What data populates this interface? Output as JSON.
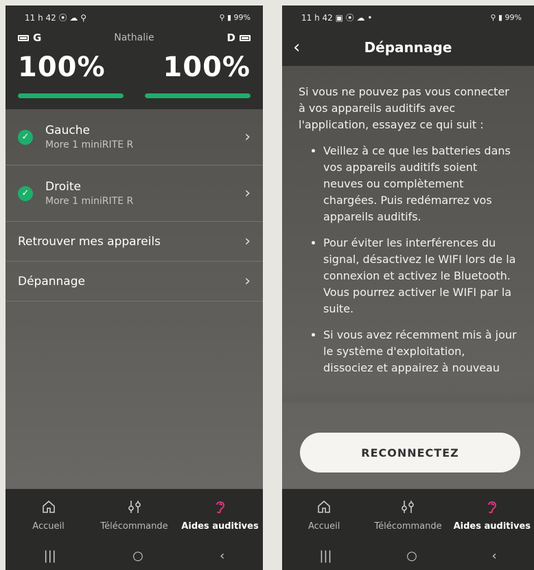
{
  "left": {
    "status": {
      "time": "11 h 42 ⦿ ☁ ⚲",
      "right": "⚲ ▮ 99%"
    },
    "left_side": "G",
    "right_side": "D",
    "user": "Nathalie",
    "left_pct": "100%",
    "right_pct": "100%",
    "left_level": 1.0,
    "right_level": 1.0,
    "devices": [
      {
        "name": "Gauche",
        "model": "More 1 miniRITE R"
      },
      {
        "name": "Droite",
        "model": "More 1 miniRITE R"
      }
    ],
    "menu": [
      "Retrouver mes appareils",
      "Dépannage"
    ]
  },
  "right": {
    "status": {
      "time": "11 h 42 ▣ ⦿ ☁ •",
      "right": "⚲ ▮ 99%"
    },
    "title": "Dépannage",
    "intro": "Si vous ne pouvez pas vous connecter à vos appareils auditifs avec l'application, essayez ce qui suit :",
    "bullets": [
      "Veillez à ce que les batteries dans vos appareils auditifs soient neuves ou complètement chargées. Puis redémarrez vos appareils auditifs.",
      "Pour éviter les interférences du signal, désactivez le WIFI lors de la connexion et activez le Bluetooth. Vous pourrez activer le WIFI par la suite.",
      "Si vous avez récemment mis à jour le système d'exploitation, dissociez et appairez à nouveau"
    ],
    "button": "RECONNECTEZ"
  },
  "nav": {
    "home": "Accueil",
    "remote": "Télécommande",
    "aids": "Aides auditives"
  },
  "sysnav": {
    "recents": "|||",
    "home": "○",
    "back": "‹"
  },
  "colors": {
    "accent_green": "#1eae6b",
    "accent_pink": "#e0337f"
  },
  "icons": {
    "home": "home-icon",
    "remote": "sliders-icon",
    "aids": "ear-icon"
  }
}
